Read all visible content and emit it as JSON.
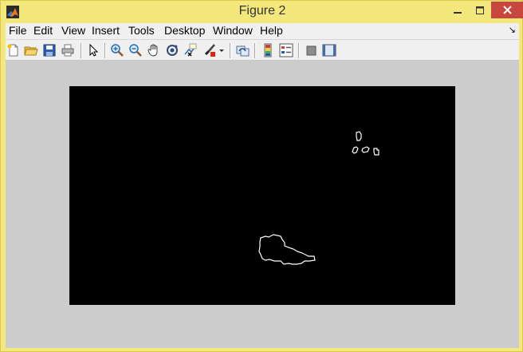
{
  "window": {
    "title": "Figure 2",
    "app_icon": "matlab-logo-icon",
    "controls": [
      "minimize-icon",
      "maximize-icon",
      "close-icon"
    ],
    "frame_color": "#f4e77b",
    "close_color": "#c7463d"
  },
  "menubar": {
    "items": [
      {
        "label": "File"
      },
      {
        "label": "Edit"
      },
      {
        "label": "View"
      },
      {
        "label": "Insert"
      },
      {
        "label": "Tools"
      },
      {
        "label": "Desktop"
      },
      {
        "label": "Window"
      },
      {
        "label": "Help"
      }
    ],
    "dock_icon": "dock-arrow-icon"
  },
  "toolbar": {
    "buttons": [
      "new-figure-icon",
      "open-file-icon",
      "save-figure-icon",
      "print-figure-icon",
      "edit-plot-arrow-icon",
      "zoom-in-icon",
      "zoom-out-icon",
      "pan-hand-icon",
      "rotate-3d-icon",
      "data-cursor-icon",
      "brush-icon",
      "brush-dropdown-icon",
      "link-plot-icon",
      "insert-colorbar-icon",
      "insert-legend-icon",
      "hide-plot-tools-icon",
      "show-plot-tools-icon"
    ]
  },
  "figure": {
    "background": "#cccccc",
    "axes_background": "#000000",
    "contour_color": "#ffffff",
    "content": "binary edge image with white outlines of small blobs (upper right) and a larger irregular shape (lower center)"
  }
}
